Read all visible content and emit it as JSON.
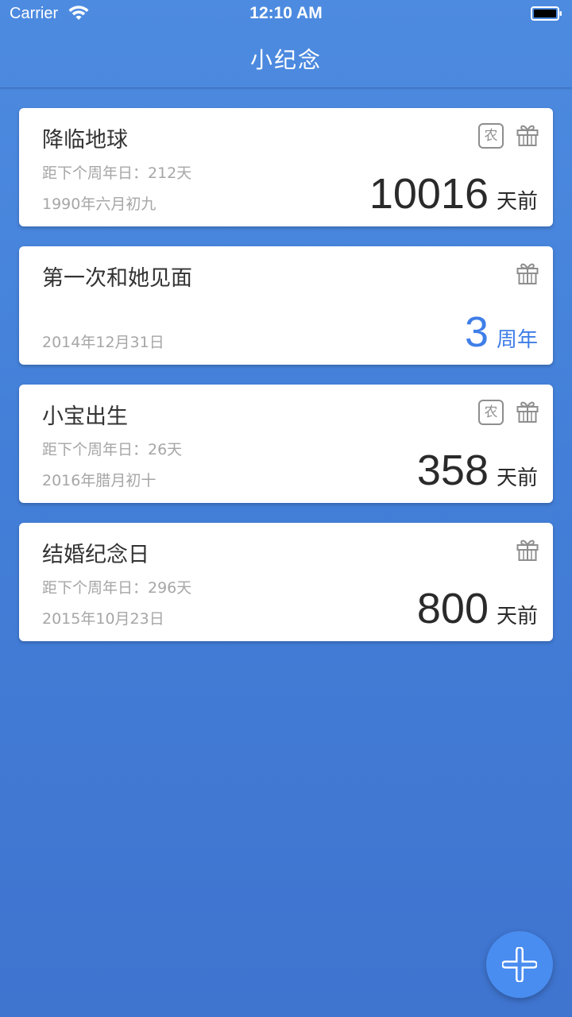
{
  "status_bar": {
    "carrier": "Carrier",
    "time": "12:10 AM",
    "icons": [
      "wifi-icon",
      "battery-icon"
    ]
  },
  "nav": {
    "title": "小纪念"
  },
  "colors": {
    "background": "#4a85dc",
    "card": "#ffffff",
    "highlight": "#3f7ee8",
    "fab": "#4a8df0"
  },
  "anniversaries": [
    {
      "title": "降临地球",
      "next": "距下个周年日：212天",
      "date": "1990年六月初九",
      "value": "10016",
      "unit": "天前",
      "lunar_badge": "农",
      "icon": "gift-icon"
    },
    {
      "title": "第一次和她见面",
      "next": "",
      "date": "2014年12月31日",
      "value": "3",
      "unit": "周年",
      "lunar_badge": "",
      "icon": "gift-icon"
    },
    {
      "title": "小宝出生",
      "next": "距下个周年日：26天",
      "date": "2016年腊月初十",
      "value": "358",
      "unit": "天前",
      "lunar_badge": "农",
      "icon": "gift-icon"
    },
    {
      "title": "结婚纪念日",
      "next": "距下个周年日：296天",
      "date": "2015年10月23日",
      "value": "800",
      "unit": "天前",
      "lunar_badge": "",
      "icon": "gift-icon"
    }
  ],
  "fab": {
    "icon": "plus-icon"
  }
}
